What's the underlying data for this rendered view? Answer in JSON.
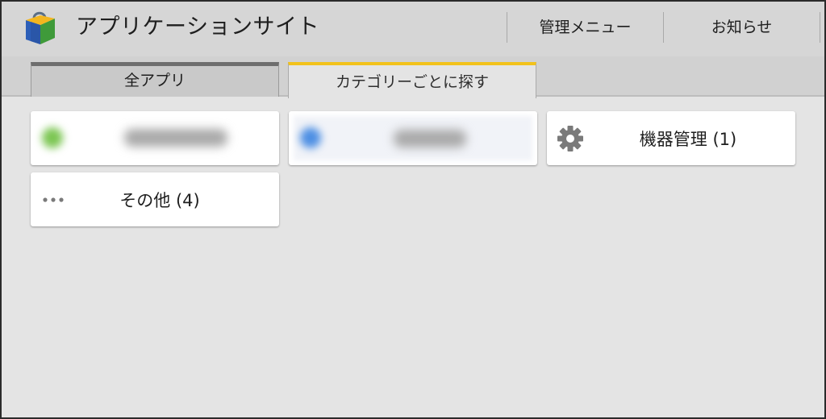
{
  "header": {
    "title": "アプリケーションサイト",
    "admin_menu": "管理メニュー",
    "notices": "お知らせ"
  },
  "tabs": [
    {
      "label": "全アプリ",
      "active": false
    },
    {
      "label": "カテゴリーごとに探す",
      "active": true
    }
  ],
  "categories": [
    {
      "label": "",
      "icon": "green-circle-icon",
      "blurred": true
    },
    {
      "label": "",
      "icon": "blue-circle-icon",
      "blurred": true
    },
    {
      "label": "機器管理 (1)",
      "icon": "gear-icon",
      "blurred": false
    },
    {
      "label": "その他 (4)",
      "icon": "more-dots-icon",
      "blurred": false
    }
  ],
  "colors": {
    "header_bg": "#d6d6d6",
    "page_bg": "#e4e4e4",
    "active_tab_accent": "#f2c21b",
    "inactive_tab_accent": "#6e6e6e",
    "card_bg": "#ffffff",
    "icon_gray": "#7a7a7a"
  }
}
